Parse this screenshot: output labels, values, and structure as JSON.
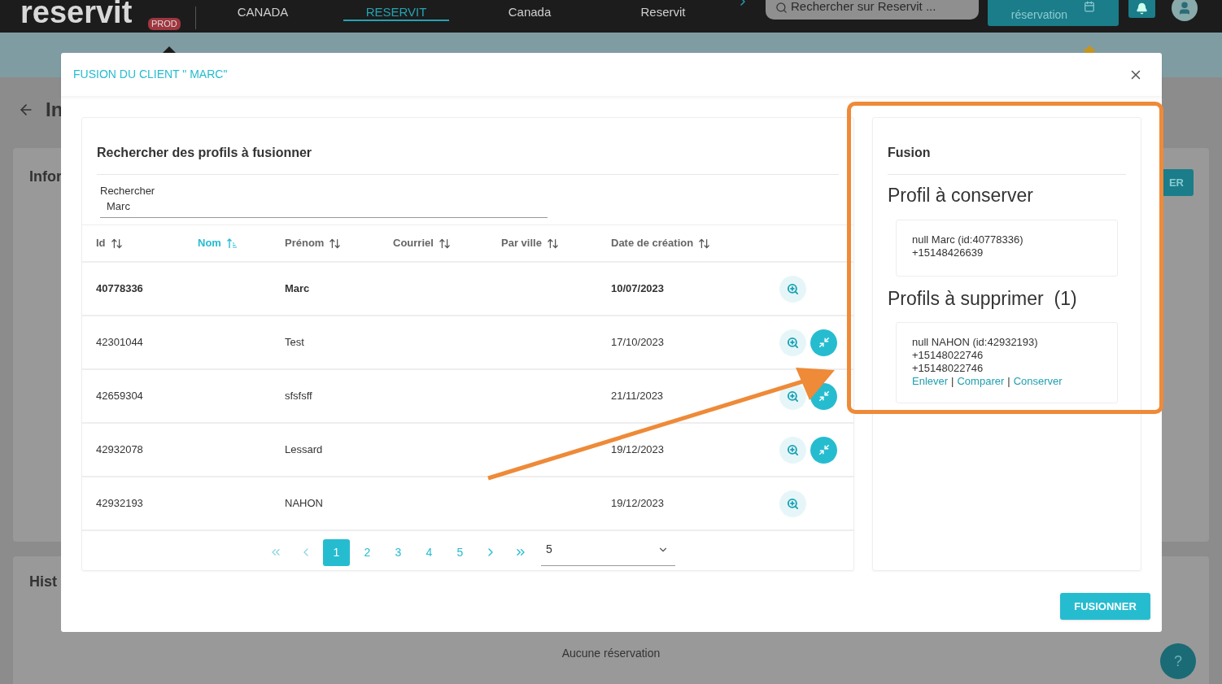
{
  "top_bar": {
    "logo": "reservit",
    "env_badge": "PROD",
    "nav": [
      {
        "label": "CANADA",
        "selected": false
      },
      {
        "label": "RESERVIT",
        "selected": true
      },
      {
        "label": "Canada",
        "selected": false
      },
      {
        "label": "Reservit",
        "selected": false
      }
    ],
    "search": {
      "placeholder": "Rechercher sur Reservit ..."
    },
    "booking_button": "réservation"
  },
  "page": {
    "title": "In",
    "sections": [
      "Infor",
      "Hist"
    ],
    "side_button": "ER",
    "empty_text": "Aucune réservation",
    "help": "?"
  },
  "modal": {
    "title": "FUSION DU CLIENT \" MARC\"",
    "search_panel": {
      "title": "Rechercher des profils à fusionner",
      "search": {
        "label": "Rechercher",
        "value": "Marc"
      },
      "columns": [
        {
          "label": "Id",
          "sorted": false
        },
        {
          "label": "Nom",
          "sorted": true
        },
        {
          "label": "Prénom",
          "sorted": false
        },
        {
          "label": "Courriel",
          "sorted": false
        },
        {
          "label": "Par ville",
          "sorted": false
        },
        {
          "label": "Date de création",
          "sorted": false
        }
      ],
      "rows": [
        {
          "id": "40778336",
          "first_name": "Marc",
          "created": "10/07/2023",
          "kept": true,
          "mergeable": false
        },
        {
          "id": "42301044",
          "first_name": "Test",
          "created": "17/10/2023",
          "kept": false,
          "mergeable": true
        },
        {
          "id": "42659304",
          "first_name": "sfsfsff",
          "created": "21/11/2023",
          "kept": false,
          "mergeable": true
        },
        {
          "id": "42932078",
          "first_name": "Lessard",
          "created": "19/12/2023",
          "kept": false,
          "mergeable": true
        },
        {
          "id": "42932193",
          "first_name": "NAHON",
          "created": "19/12/2023",
          "kept": false,
          "mergeable": false
        }
      ],
      "pages": [
        {
          "label": "1",
          "selected": true
        },
        {
          "label": "2",
          "selected": false
        },
        {
          "label": "3",
          "selected": false
        },
        {
          "label": "4",
          "selected": false
        },
        {
          "label": "5",
          "selected": false
        }
      ],
      "page_size": "5"
    },
    "fusion_panel": {
      "title": "Fusion",
      "keep_heading": "Profil à conserver",
      "keep_card": [
        "null Marc (id:40778336)",
        "+15148426639"
      ],
      "delete_heading": "Profils à supprimer  (1)",
      "delete_cards": [
        {
          "lines": [
            "null NAHON (id:42932193)",
            "+15148022746",
            "+15148022746"
          ],
          "links": [
            "Enlever",
            "Comparer",
            "Conserver"
          ],
          "separator": "|"
        }
      ]
    },
    "submit": "FUSIONNER"
  },
  "annotations": {
    "frame": true,
    "arrow": true
  }
}
